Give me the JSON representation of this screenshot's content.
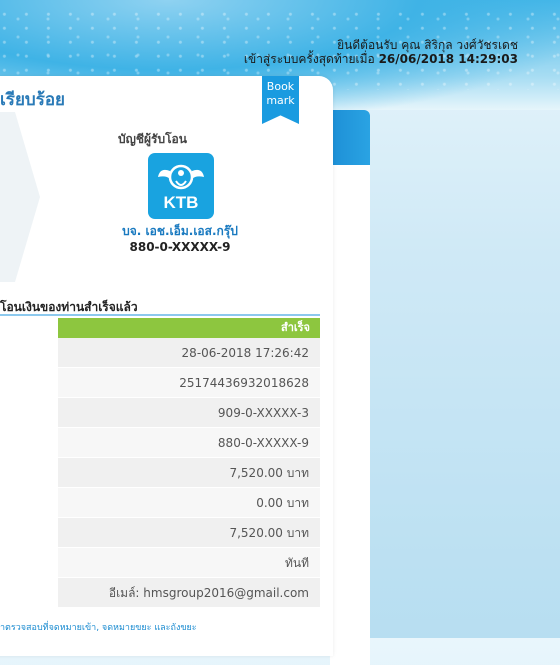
{
  "header": {
    "welcome_line": "ยินดีต้อนรับ คุณ สิริกุล วงศ์วัชรเดช",
    "last_login_label": "เข้าสู่ระบบครั้งสุดท้ายเมื่อ",
    "last_login_time": "26/06/2018 14:29:03"
  },
  "page": {
    "title": "เรียบร้อย",
    "bookmark_line1": "Book",
    "bookmark_line2": "mark"
  },
  "recipient": {
    "label": "บัญชีผู้รับโอน",
    "bank_logo_text": "KTB",
    "bank_logo_icon": "krungthai-bird-icon",
    "name": "บจ. เอช.เอ็ม.เอส.กรุ๊ป",
    "account": "880-0-XXXXX-9"
  },
  "result": {
    "heading": "โอนเงินของท่านสำเร็จแล้ว",
    "status": "สำเร็จ",
    "rows": [
      "28-06-2018 17:26:42",
      "25174436932018628",
      "909-0-XXXXX-3",
      "880-0-XXXXX-9",
      "7,520.00 บาท",
      "0.00 บาท",
      "7,520.00 บาท",
      "ทันที",
      "อีเมล์: hmsgroup2016@gmail.com"
    ]
  },
  "footer": {
    "note": "าตรวจสอบที่จดหมายเข้า, จดหมายขยะ และถังขยะ"
  },
  "colors": {
    "accent": "#1a9be0",
    "success": "#8dc63f",
    "title": "#2a7ab7"
  }
}
